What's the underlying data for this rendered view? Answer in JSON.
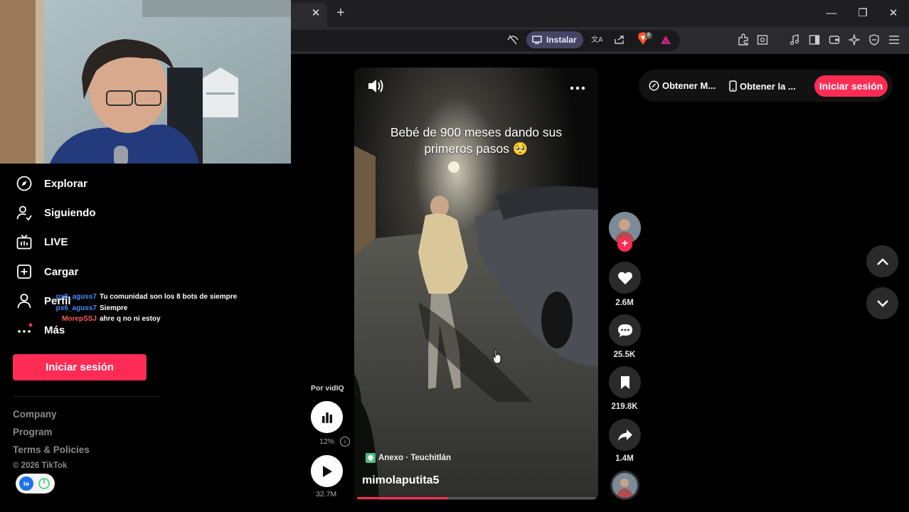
{
  "browser": {
    "tab_close": "✕",
    "new_tab": "+",
    "window": {
      "minimize": "—",
      "maximize": "❐",
      "close": "✕"
    },
    "install_label": "Instalar",
    "brave_badge_count": "8"
  },
  "sidebar": {
    "items": [
      {
        "label": "Explorar",
        "icon": "compass-icon"
      },
      {
        "label": "Siguiendo",
        "icon": "user-follow-icon"
      },
      {
        "label": "LIVE",
        "icon": "live-tv-icon"
      },
      {
        "label": "Cargar",
        "icon": "upload-plus-icon"
      },
      {
        "label": "Perfil",
        "icon": "person-icon"
      },
      {
        "label": "Más",
        "icon": "more-dots-icon"
      }
    ],
    "login_label": "Iniciar sesión",
    "footer_links": [
      "Company",
      "Program",
      "Terms & Policies"
    ],
    "copyright": "© 2026 TikTok"
  },
  "chat": [
    {
      "user": "px6_aguss7",
      "message": "Tu comunidad son los 8 bots de siempre",
      "color": "#4a8cff"
    },
    {
      "user": "px6_aguss7",
      "message": "Siempre",
      "color": "#4a8cff"
    },
    {
      "user": "MorepSSJ",
      "message": "ahre q no ni estoy",
      "color": "#ff5b5b"
    }
  ],
  "video": {
    "caption": "Bebé de 900 meses dando sus primeros pasos 🥺",
    "location": "Anexo · Teuchitlán",
    "username": "mimolaputita5",
    "progress": 0.38
  },
  "actions": {
    "likes": "2.6M",
    "comments": "25.5K",
    "saves": "219.8K",
    "shares": "1.4M"
  },
  "vidiq": {
    "label": "Por vidIQ",
    "percent": "12%",
    "views": "32.7M"
  },
  "header": {
    "get_coins": "Obtener M...",
    "get_app": "Obtener la ...",
    "login": "Iniciar sesión"
  },
  "colors": {
    "accent": "#fe2c55",
    "background": "#000000",
    "browser_chrome": "#2b2b2f"
  }
}
